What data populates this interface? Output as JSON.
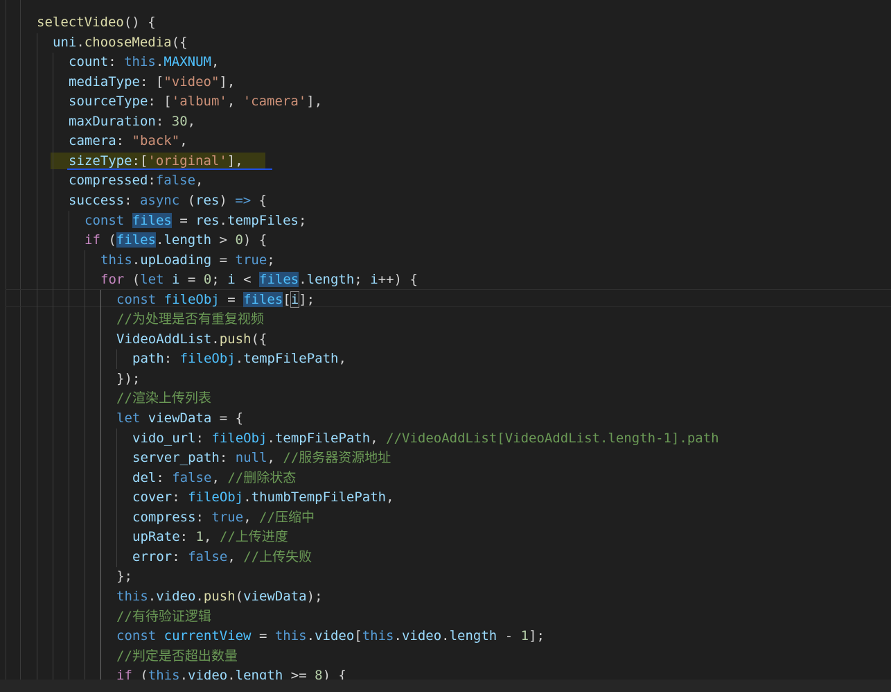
{
  "code": [
    "selectVideo() {",
    "uni.chooseMedia({",
    "count: this.MAXNUM,",
    "mediaType: [\"video\"],",
    "sourceType: ['album', 'camera'],",
    "maxDuration: 30,",
    "camera: \"back\",",
    "sizeType:['original'],",
    "compressed:false,",
    "success: async (res) => {",
    "const files = res.tempFiles;",
    "if (files.length > 0) {",
    "this.upLoading = true;",
    "for (let i = 0; i < files.length; i++) {",
    "const fileObj = files[i];",
    "//为处理是否有重复视频",
    "VideoAddList.push({",
    "path: fileObj.tempFilePath,",
    "});",
    "//渲染上传列表",
    "let viewData = {",
    "vido_url: fileObj.tempFilePath, //VideoAddList[VideoAddList.length-1].path",
    "server_path: null, //服务器资源地址",
    "del: false, //删除状态",
    "cover: fileObj.thumbTempFilePath,",
    "compress: true, //压缩中",
    "upRate: 1, //上传进度",
    "error: false, //上传失败",
    "};",
    "this.video.push(viewData);",
    "//有待验证逻辑",
    "const currentView = this.video[this.video.length - 1];",
    "//判定是否超出数量",
    "if (this.video.length >= 8) {"
  ],
  "colors": {
    "background": "#1f1f1f",
    "keyword": "#569cd6",
    "control": "#c586c0",
    "property": "#9cdcfe",
    "function": "#dcdcaa",
    "string": "#ce9178",
    "number": "#b5cea8",
    "comment": "#6a9955",
    "constant": "#4fc1ff",
    "underline": "#1e50e6"
  }
}
